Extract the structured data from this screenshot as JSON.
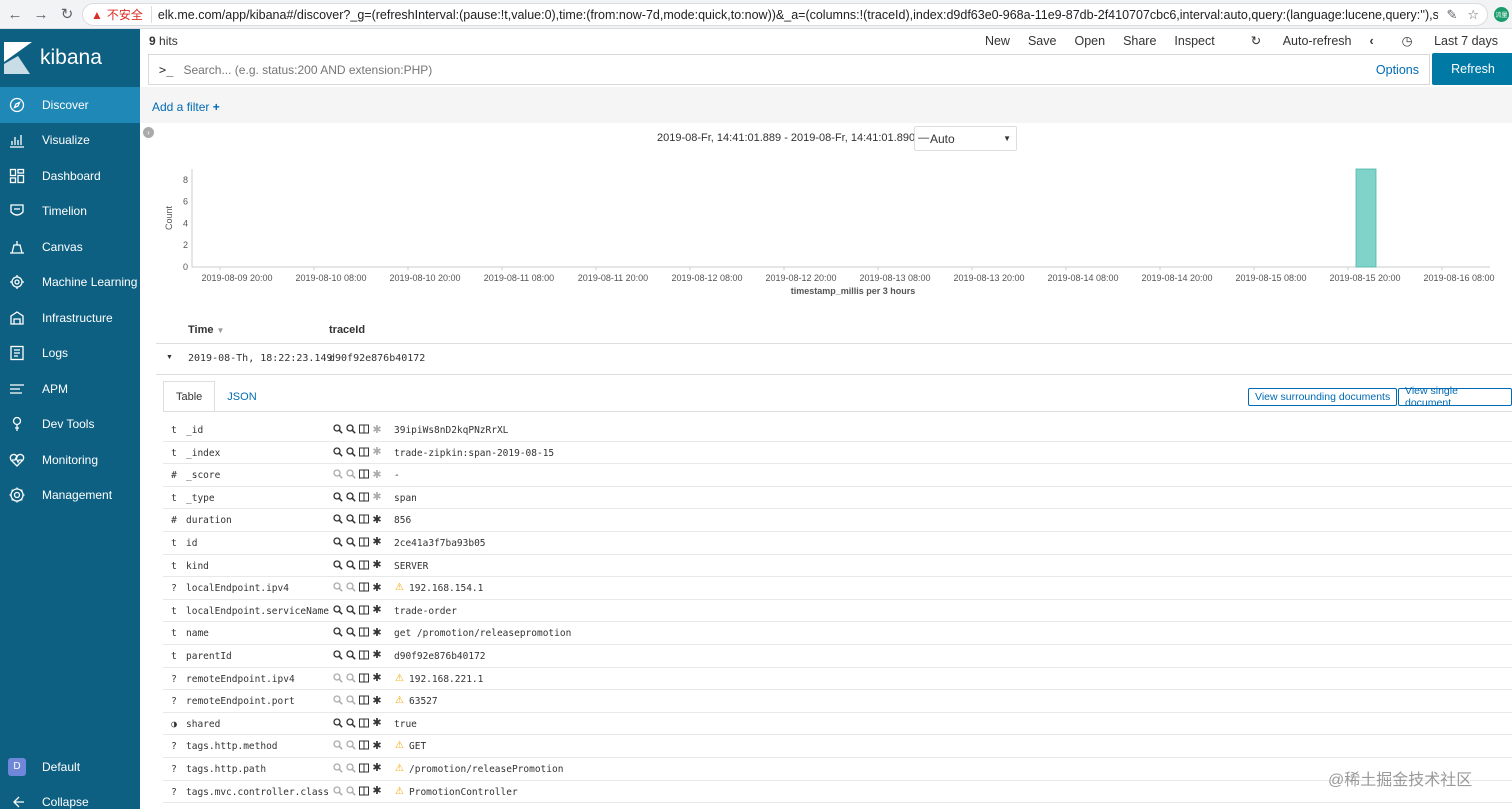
{
  "browser": {
    "insecure_label": "不安全",
    "url": "elk.me.com/app/kibana#/discover?_g=(refreshInterval:(pause:!t,value:0),time:(from:now-7d,mode:quick,to:now))&_a=(columns:!(traceId),index:d9df63e0-968a-11e9-87db-2f410707cbc6,interval:auto,query:(language:lucene,query:''),sort:!",
    "avatar": "流量"
  },
  "sidebar": {
    "brand": "kibana",
    "items": [
      {
        "label": "Discover",
        "icon": "compass-icon"
      },
      {
        "label": "Visualize",
        "icon": "chart-icon"
      },
      {
        "label": "Dashboard",
        "icon": "dashboard-icon"
      },
      {
        "label": "Timelion",
        "icon": "timelion-icon"
      },
      {
        "label": "Canvas",
        "icon": "canvas-icon"
      },
      {
        "label": "Machine Learning",
        "icon": "ml-icon"
      },
      {
        "label": "Infrastructure",
        "icon": "infra-icon"
      },
      {
        "label": "Logs",
        "icon": "logs-icon"
      },
      {
        "label": "APM",
        "icon": "apm-icon"
      },
      {
        "label": "Dev Tools",
        "icon": "wrench-icon"
      },
      {
        "label": "Monitoring",
        "icon": "heartbeat-icon"
      },
      {
        "label": "Management",
        "icon": "gear-icon"
      }
    ],
    "space_badge": "D",
    "space_label": "Default",
    "collapse_label": "Collapse"
  },
  "topbar": {
    "hits_count": "9",
    "hits_label": "hits",
    "menu": {
      "new": "New",
      "save": "Save",
      "open": "Open",
      "share": "Share",
      "inspect": "Inspect",
      "auto_refresh": "Auto-refresh",
      "time": "Last 7 days"
    }
  },
  "query": {
    "prompt": ">_",
    "placeholder": "Search... (e.g. status:200 AND extension:PHP)",
    "options": "Options",
    "refresh": "Refresh"
  },
  "filter": {
    "add_filter": "Add a filter"
  },
  "histogram": {
    "range_text": "2019-08-Fr, 14:41:01.889 - 2019-08-Fr, 14:41:01.890 —",
    "interval": "Auto"
  },
  "chart_data": {
    "type": "bar",
    "title": "",
    "xlabel": "timestamp_millis per 3 hours",
    "ylabel": "Count",
    "ylim": [
      0,
      9
    ],
    "yticks": [
      "0",
      "2",
      "4",
      "6",
      "8"
    ],
    "categories": [
      "2019-08-09 20:00",
      "2019-08-10 08:00",
      "2019-08-10 20:00",
      "2019-08-11 08:00",
      "2019-08-11 20:00",
      "2019-08-12 08:00",
      "2019-08-12 20:00",
      "2019-08-13 08:00",
      "2019-08-13 20:00",
      "2019-08-14 08:00",
      "2019-08-14 20:00",
      "2019-08-15 08:00",
      "2019-08-15 20:00",
      "2019-08-16 08:00"
    ],
    "bars": [
      {
        "x_fraction": 12.0,
        "value": 9
      }
    ],
    "bar_color": "#7fd3c9",
    "grid": false
  },
  "table": {
    "col_time": "Time",
    "col_trace": "traceId",
    "doc_time": "2019-08-Th, 18:22:23.149",
    "doc_trace": "d90f92e876b40172",
    "tab_table": "Table",
    "tab_json": "JSON",
    "btn_surrounding": "View surrounding documents",
    "btn_single": "View single document"
  },
  "fields": [
    {
      "type": "t",
      "name": "_id",
      "value": "39ipiWs8nD2kqPNzRrXL",
      "warn": false,
      "dim": false
    },
    {
      "type": "t",
      "name": "_index",
      "value": "trade-zipkin:span-2019-08-15",
      "warn": false,
      "dim": false
    },
    {
      "type": "#",
      "name": "_score",
      "value": " -",
      "warn": false,
      "dim": true
    },
    {
      "type": "t",
      "name": "_type",
      "value": "span",
      "warn": false,
      "dim": false
    },
    {
      "type": "#",
      "name": "duration",
      "value": "856",
      "warn": false,
      "dim": false
    },
    {
      "type": "t",
      "name": "id",
      "value": "2ce41a3f7ba93b05",
      "warn": false,
      "dim": false
    },
    {
      "type": "t",
      "name": "kind",
      "value": "SERVER",
      "warn": false,
      "dim": false
    },
    {
      "type": "?",
      "name": "localEndpoint.ipv4",
      "value": "192.168.154.1",
      "warn": true,
      "dim": true
    },
    {
      "type": "t",
      "name": "localEndpoint.serviceName",
      "value": "trade-order",
      "warn": false,
      "dim": false
    },
    {
      "type": "t",
      "name": "name",
      "value": "get /promotion/releasepromotion",
      "warn": false,
      "dim": false
    },
    {
      "type": "t",
      "name": "parentId",
      "value": "d90f92e876b40172",
      "warn": false,
      "dim": false
    },
    {
      "type": "?",
      "name": "remoteEndpoint.ipv4",
      "value": "192.168.221.1",
      "warn": true,
      "dim": true
    },
    {
      "type": "?",
      "name": "remoteEndpoint.port",
      "value": "63527",
      "warn": true,
      "dim": true
    },
    {
      "type": "◑",
      "name": "shared",
      "value": "true",
      "warn": false,
      "dim": false
    },
    {
      "type": "?",
      "name": "tags.http.method",
      "value": "GET",
      "warn": true,
      "dim": true
    },
    {
      "type": "?",
      "name": "tags.http.path",
      "value": "/promotion/releasePromotion",
      "warn": true,
      "dim": true
    },
    {
      "type": "?",
      "name": "tags.mvc.controller.class",
      "value": "PromotionController",
      "warn": true,
      "dim": true
    }
  ],
  "watermark": "@稀土掘金技术社区"
}
